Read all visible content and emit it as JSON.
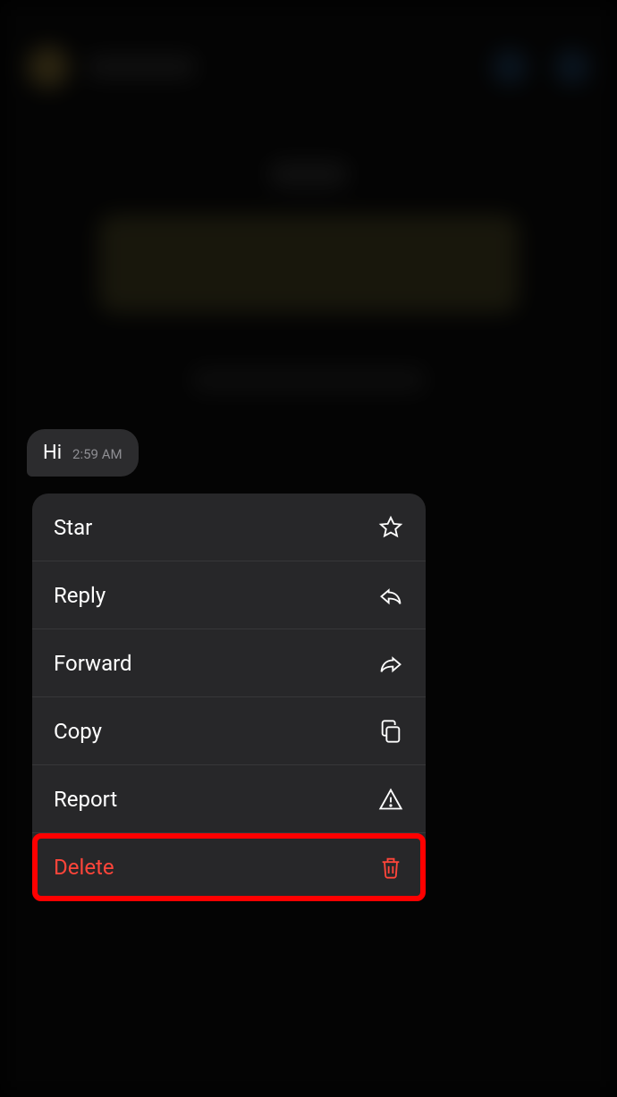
{
  "message": {
    "text": "Hi",
    "time": "2:59 AM"
  },
  "menu": {
    "star": {
      "label": "Star"
    },
    "reply": {
      "label": "Reply"
    },
    "forward": {
      "label": "Forward"
    },
    "copy": {
      "label": "Copy"
    },
    "report": {
      "label": "Report"
    },
    "delete": {
      "label": "Delete"
    }
  },
  "colors": {
    "danger": "#ff453a",
    "menu_bg": "#272729",
    "bubble_bg": "#2c2c2e"
  }
}
